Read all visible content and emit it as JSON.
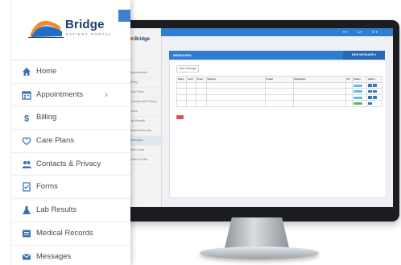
{
  "brand": {
    "name": "Bridge",
    "tagline": "PATIENT PORTAL",
    "colors": {
      "primary": "#1f3d6b",
      "accent": "#f08a2c",
      "blue": "#2f7dd1"
    }
  },
  "sidebar": {
    "items": [
      {
        "label": "Home",
        "icon": "home-icon"
      },
      {
        "label": "Appointments",
        "icon": "calendar-icon",
        "chevron": "›"
      },
      {
        "label": "Billing",
        "icon": "dollar-icon"
      },
      {
        "label": "Care Plans",
        "icon": "heart-icon"
      },
      {
        "label": "Contacts & Privacy",
        "icon": "contacts-icon"
      },
      {
        "label": "Forms",
        "icon": "form-icon"
      },
      {
        "label": "Lab Results",
        "icon": "flask-icon"
      },
      {
        "label": "Medical Records",
        "icon": "records-icon"
      },
      {
        "label": "Messages",
        "icon": "envelope-icon"
      }
    ]
  },
  "screen": {
    "logo": "Bridge",
    "nav": [
      "",
      "Appointments",
      "Billing",
      "Care Plans",
      "Contacts and Privacy",
      "Forms",
      "Lab Results",
      "Medical Records",
      "Messages",
      "Other Links",
      "Patient Profile"
    ],
    "topbar": {
      "a": "▾ ▾",
      "b": "A ▾",
      "c": "☰ ▾"
    },
    "page_title": "MESSAGES",
    "header_button": "NEW MESSAGE ▾",
    "new_button": "New Message",
    "table": {
      "headers": [
        "Read",
        "Sent",
        "From",
        "Subject",
        "Folder",
        "Recipients",
        "Att",
        "Status",
        "Action"
      ],
      "rows": [
        [
          "",
          "",
          "",
          "",
          "",
          "",
          "",
          "info",
          ""
        ],
        [
          "",
          "",
          "",
          "",
          "",
          "",
          "",
          "info",
          ""
        ],
        [
          "",
          "",
          "",
          "",
          "",
          "",
          "",
          "info",
          ""
        ],
        [
          "",
          "",
          "",
          "",
          "",
          "",
          "",
          "success",
          ""
        ]
      ]
    }
  }
}
